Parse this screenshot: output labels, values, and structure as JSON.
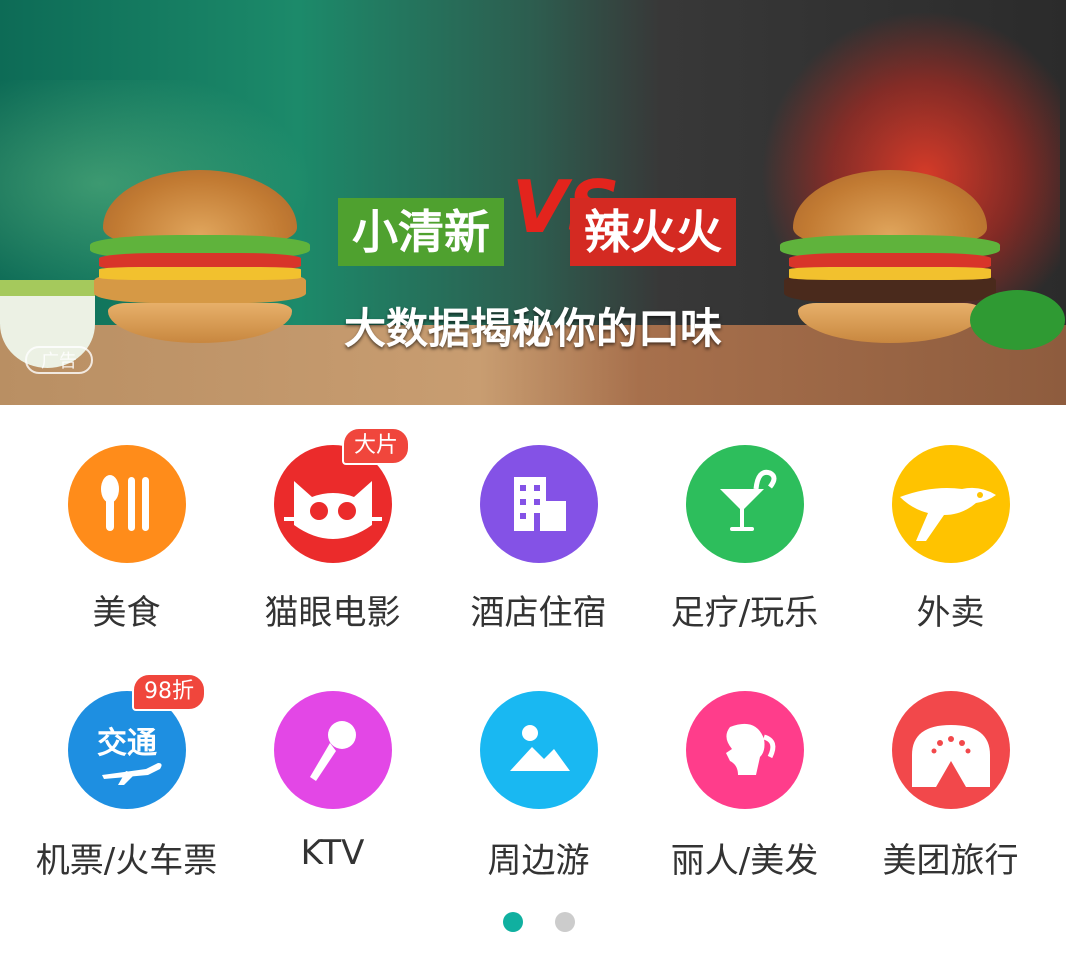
{
  "banner": {
    "tag_left": "小清新",
    "vs": "VS",
    "tag_right": "辣火火",
    "slogan": "大数据揭秘你的口味",
    "ad_label": "广告"
  },
  "categories": [
    {
      "label": "美食",
      "icon": "utensils-icon",
      "color": "#FF8C1A"
    },
    {
      "label": "猫眼电影",
      "icon": "cat-eye-icon",
      "color": "#EB2B2B",
      "badge": "大片"
    },
    {
      "label": "酒店住宿",
      "icon": "building-icon",
      "color": "#8452E6"
    },
    {
      "label": "足疗/玩乐",
      "icon": "cocktail-icon",
      "color": "#2DBE5C"
    },
    {
      "label": "外卖",
      "icon": "kangaroo-icon",
      "color": "#FFC300"
    },
    {
      "label": "机票/火车票",
      "icon": "plane-ticket-icon",
      "color": "#1E8FE1",
      "badge": "98折",
      "icon_text": "交通"
    },
    {
      "label": "KTV",
      "icon": "microphone-icon",
      "color": "#E347E6"
    },
    {
      "label": "周边游",
      "icon": "landscape-icon",
      "color": "#19B8F2"
    },
    {
      "label": "丽人/美发",
      "icon": "woman-profile-icon",
      "color": "#FF3D8B"
    },
    {
      "label": "美团旅行",
      "icon": "tent-icon",
      "color": "#F2484B"
    }
  ],
  "pagination": {
    "pages": 2,
    "active": 1,
    "active_color": "#10B0A0",
    "inactive_color": "#CCCCCC"
  }
}
